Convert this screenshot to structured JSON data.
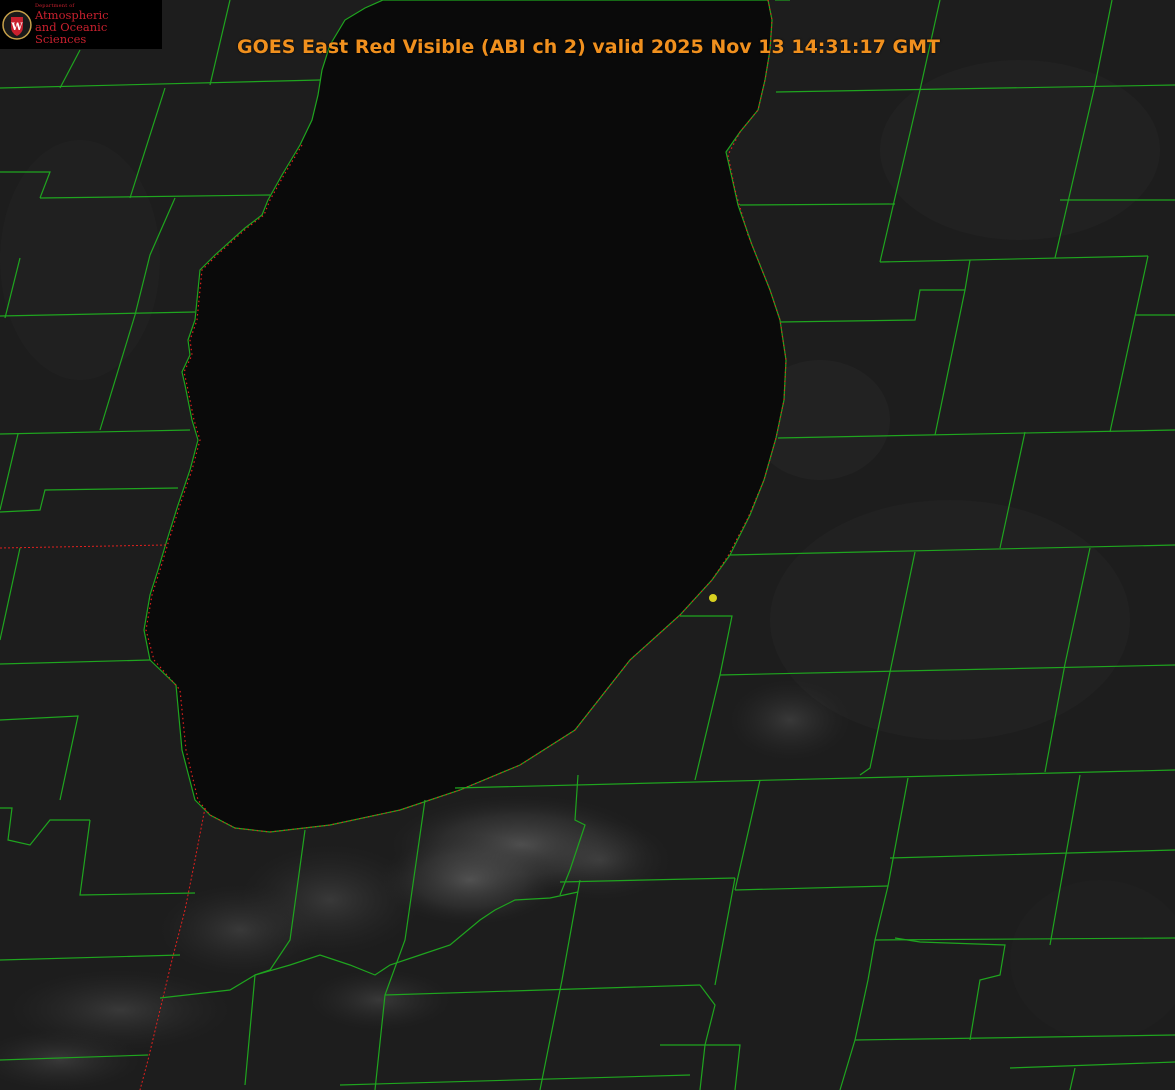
{
  "product_title": "GOES East Red Visible (ABI ch 2) valid 2025 Nov 13 14:31:17 GMT",
  "logo": {
    "department": "Department of",
    "line1": "Atmospheric",
    "line2": "and Oceanic Sciences",
    "seal_letter": "W",
    "seal_color": "#c8202e"
  },
  "colors": {
    "county_lines": "#1fa51f",
    "state_border": "#e0201e",
    "station_marker": "#d8d020",
    "title": "#f0901e"
  },
  "icons": [
    "uw-seal-icon",
    "station-marker-icon"
  ]
}
